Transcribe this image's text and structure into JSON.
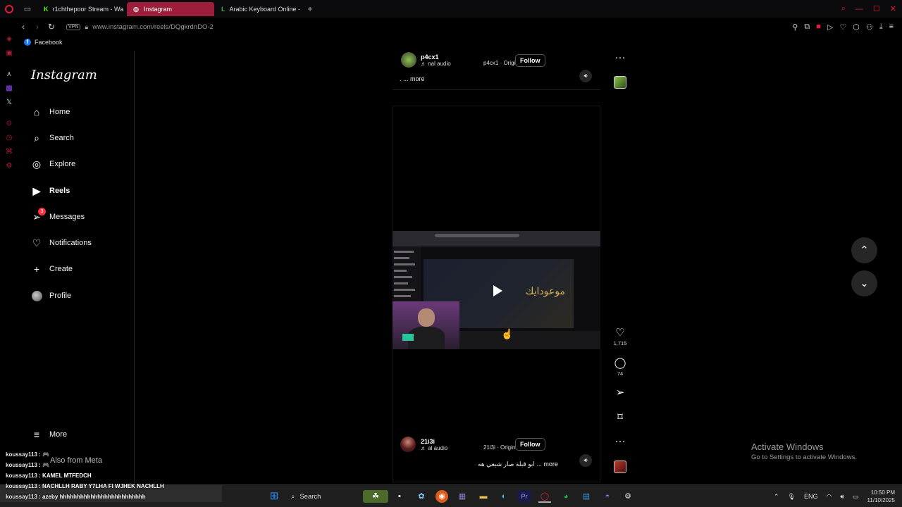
{
  "browser": {
    "tabs": [
      {
        "label": "r1chthepoor Stream - Wa",
        "favicon": "K",
        "favicon_color": "#53fc18"
      },
      {
        "label": "Instagram",
        "favicon": "◎",
        "favicon_color": "#ffffff"
      },
      {
        "label": "Arabic Keyboard Online -",
        "favicon": "L",
        "favicon_color": "#3bb143"
      }
    ],
    "vpn_label": "VPN",
    "url": "www.instagram.com/reels/DQgkrdnDO-2",
    "bookmark": "Facebook",
    "accent": "#e5193d"
  },
  "instagram": {
    "logo": "Instagram",
    "nav": [
      {
        "label": "Home",
        "icon": "⌂",
        "name": "home"
      },
      {
        "label": "Search",
        "icon": "⌕",
        "name": "search"
      },
      {
        "label": "Explore",
        "icon": "◎",
        "name": "explore"
      },
      {
        "label": "Reels",
        "icon": "▶",
        "name": "reels"
      },
      {
        "label": "Messages",
        "icon": "➢",
        "name": "messages",
        "badge": "3"
      },
      {
        "label": "Notifications",
        "icon": "♡",
        "name": "notifications"
      },
      {
        "label": "Create",
        "icon": "+",
        "name": "create"
      },
      {
        "label": "Profile",
        "icon": "",
        "name": "profile"
      }
    ],
    "more": "More",
    "also_from_meta": "Also from Meta",
    "reel_top": {
      "username": "p4cx1",
      "audio": "♬ nal audio",
      "origin": "p4cx1 · Origi",
      "follow": "Follow",
      "caption": ". ... more",
      "more_dots": "···"
    },
    "reel_main": {
      "username": "21i3i",
      "audio": "♬ al audio",
      "origin": "21i3i · Origin",
      "follow": "Follow",
      "caption": "ابو قبلة صار شيعي هه ... more",
      "video_text": "موعودايك",
      "likes": "1,715",
      "comments": "74",
      "more_dots": "···"
    }
  },
  "windows": {
    "activate_title": "Activate Windows",
    "activate_sub": "Go to Settings to activate Windows.",
    "search_label": "Search",
    "lang": "ENG",
    "time": "10:50 PM",
    "date": "11/10/2025"
  },
  "chat": [
    {
      "user": "koussay113",
      "msg": ": 🎮"
    },
    {
      "user": "koussay113",
      "msg": ": 🎮"
    },
    {
      "user": "koussay113",
      "msg": ": KAMEL MTFEDCH"
    },
    {
      "user": "koussay113",
      "msg": ": NACHLLH RABY Y7LHA FI WJHEK NACHLLH"
    },
    {
      "user": "koussay113",
      "msg": ": azeby hhhhhhhhhhhhhhhhhhhhhhhhh"
    }
  ]
}
